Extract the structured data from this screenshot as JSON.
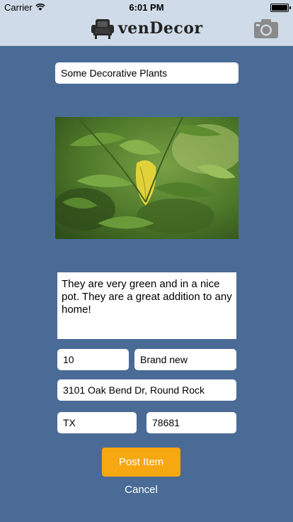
{
  "status_bar": {
    "carrier": "Carrier",
    "time": "6:01 PM"
  },
  "header": {
    "app_name": "venDecor",
    "camera_icon": "camera-icon",
    "logo_icon": "armchair-icon"
  },
  "form": {
    "title_value": "Some Decorative Plants",
    "photo_icon": "plant-photo",
    "description": "They are very green and in a nice pot. They are a great addition to any home!",
    "price": "10",
    "condition": "Brand new",
    "address": "3101 Oak Bend Dr, Round Rock",
    "state": "TX",
    "zip": "78681"
  },
  "actions": {
    "post_label": "Post Item",
    "cancel_label": "Cancel"
  },
  "colors": {
    "background": "#4a6b95",
    "navbar": "#cfdbe8",
    "accent": "#f7a70f"
  }
}
